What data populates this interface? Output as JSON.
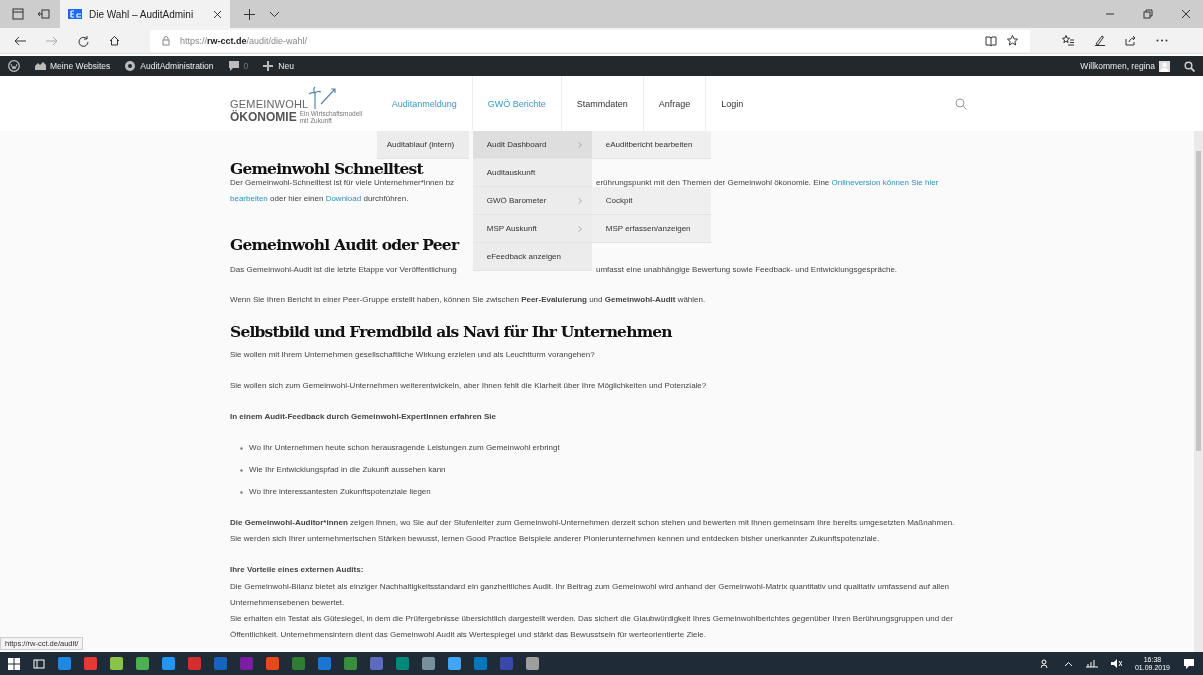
{
  "browser": {
    "tabs": [
      {
        "title": "Die Wahl – AuditAdmini",
        "selected": true
      }
    ],
    "url": {
      "scheme": "https://",
      "host": "rw-cct.de",
      "path": "/audit/die-wahl/"
    }
  },
  "admin_bar": {
    "items": [
      {
        "kind": "sites",
        "label": "Meine Websites"
      },
      {
        "kind": "admin",
        "label": "AuditAdministration"
      },
      {
        "kind": "comments",
        "label": "0"
      },
      {
        "kind": "new",
        "label": "Neu"
      }
    ],
    "greeting": "Willkommen, regina"
  },
  "site": {
    "logo": {
      "line1": "GEMEINWOHL",
      "line2": "ÖKONOMIE",
      "tagline": "Ein Wirtschaftsmodell mit Zukunft"
    },
    "nav": [
      {
        "label": "Auditanmeldung",
        "highlighted": true,
        "children": [
          {
            "label": "Auditablauf (intern)",
            "selected": false
          }
        ]
      },
      {
        "label": "GWÖ Berichte",
        "highlighted": true,
        "children": [
          {
            "label": "Audit Dashboard",
            "selected": true,
            "children": [
              {
                "label": "eAuditbericht bearbeiten"
              }
            ]
          },
          {
            "label": "Auditauskunft",
            "selected": false
          },
          {
            "label": "GWÖ Barometer",
            "selected": false,
            "children": [
              {
                "label": "Cockpit"
              }
            ]
          },
          {
            "label": "MSP Auskunft",
            "selected": false,
            "children": [
              {
                "label": "MSP erfassen/anzeigen"
              }
            ]
          },
          {
            "label": "eFeedback anzeigen",
            "selected": false
          }
        ]
      },
      {
        "label": "Stammdaten",
        "highlighted": false
      },
      {
        "label": "Anfrage",
        "highlighted": false
      },
      {
        "label": "Login",
        "highlighted": false
      }
    ]
  },
  "content": [
    {
      "kind": "heading",
      "text": "Gemeinwohl Schnelltest"
    },
    {
      "kind": "split",
      "lines": [
        {
          "left": [
            {
              "text": "Der Gemeinwohl-Schnelltest ist für viele Unternehmer*innen bz",
              "link": false
            }
          ],
          "right": [
            {
              "text": "erührungspunkt mit den Themen der Gemeinwohl ökonomie. Eine ",
              "link": false
            },
            {
              "text": "Onlineversion können Sie hier",
              "link": true
            }
          ]
        },
        {
          "left": [
            {
              "text": "bearbeiten",
              "link": true
            },
            {
              "text": " oder hier einen ",
              "link": false
            },
            {
              "text": "Download",
              "link": true
            },
            {
              "text": " durchführen.",
              "link": false
            }
          ]
        }
      ]
    },
    {
      "kind": "heading",
      "text": "Gemeinwohl Audit oder Peer"
    },
    {
      "kind": "split",
      "lines": [
        {
          "left": [
            {
              "text": "Das Gemeinwohl-Audit ist die letzte Etappe vor Veröffentlichung",
              "link": false
            }
          ],
          "right": [
            {
              "text": "umfasst eine unabhängige Bewertung sowie Feedback- und Entwicklungsgespräche.",
              "link": false
            }
          ]
        }
      ]
    },
    {
      "kind": "paragraph",
      "text": "Wenn Sie Ihren Bericht in einer Peer-Gruppe erstellt haben, können Sie zwischen **Peer-Evaluierung** und **Gemeinwohl-Audit** wählen."
    },
    {
      "kind": "heading",
      "text": "Selbstbild und Fremdbild als Navi für Ihr Unternehmen"
    },
    {
      "kind": "paragraph",
      "text": "Sie wollen mit Ihrem Unternehmen gesellschaftliche Wirkung erzielen und als Leuchtturm vorangehen?"
    },
    {
      "kind": "paragraph",
      "text": "Sie wollen sich zum Gemeinwohl-Unternehmen weiterentwickeln, aber Ihnen fehlt die Klarheit über Ihre Möglichkeiten und Potenziale?"
    },
    {
      "kind": "strong",
      "text": "In einem Audit-Feedback durch Gemeinwohl-ExpertInnen erfahren Sie"
    },
    {
      "kind": "bullets",
      "items": [
        "Wo Ihr Unternehmen heute schon herausragende Leistungen zum Gemeinwohl erbringt",
        "Wie Ihr Entwicklungspfad in die Zukunft aussehen kann",
        "Wo Ihre interessantesten Zukunftspotenziale liegen"
      ]
    },
    {
      "kind": "paragraph",
      "text": "**Die Gemeinwohl-Auditor*innen** zeigen Ihnen, wo Sie auf der Stufenleiter zum Gemeinwohl-Unternehmen derzeit schon stehen und bewerten mit Ihnen gemeinsam Ihre bereits umgesetzten Maßnahmen. Sie werden sich Ihrer unternehmerischen Stärken bewusst, lernen Good Practice Beispiele anderer Pionierunternehmen kennen und entdecken bisher unerkannter Zukunftspotenziale."
    },
    {
      "kind": "strong",
      "text": "Ihre Vorteile eines externen Audits:"
    },
    {
      "kind": "compact",
      "text": "Die Gemeinwohl-Bilanz bietet als einziger Nachhaltigkeitsstandard ein ganzheitliches Audit. Ihr Beitrag zum Gemeinwohl wird anhand der Gemeinwohl-Matrix quantitativ und qualitativ umfassend auf allen Unternehmensebenen bewertet."
    },
    {
      "kind": "compact",
      "text": "Sie erhalten ein Testat als Gütesiegel, in dem die Prüfergebnisse übersichtlich dargestellt werden. Das sichert die Glaubwürdigkeit Ihres Gemeinwohlberichtes gegenüber Ihren Berührungsgruppen und der Öffentlichkeit. Unternehmensintern dient das Gemeinwohl Audit als Wertespiegel und stärkt das Bewusstsein für werteorientierte Ziele."
    }
  ],
  "status_url": "https://rw-cct.de/audit/",
  "taskbar": {
    "apps": [
      {
        "color": "#1e88e5"
      },
      {
        "color": "#e53935"
      },
      {
        "color": "#8bc34a"
      },
      {
        "color": "#4caf50"
      },
      {
        "color": "#2196f3"
      },
      {
        "color": "#d32f2f"
      },
      {
        "color": "#1565c0"
      },
      {
        "color": "#7b1fa2"
      },
      {
        "color": "#e64a19"
      },
      {
        "color": "#2e7d32"
      },
      {
        "color": "#1976d2"
      },
      {
        "color": "#388e3c"
      },
      {
        "color": "#5c6bc0"
      },
      {
        "color": "#00897b"
      },
      {
        "color": "#78909c"
      },
      {
        "color": "#42a5f5"
      },
      {
        "color": "#0277bd"
      },
      {
        "color": "#3949ab"
      },
      {
        "color": "#9e9e9e"
      }
    ],
    "time": "16:38",
    "date": "01.09.2019"
  }
}
